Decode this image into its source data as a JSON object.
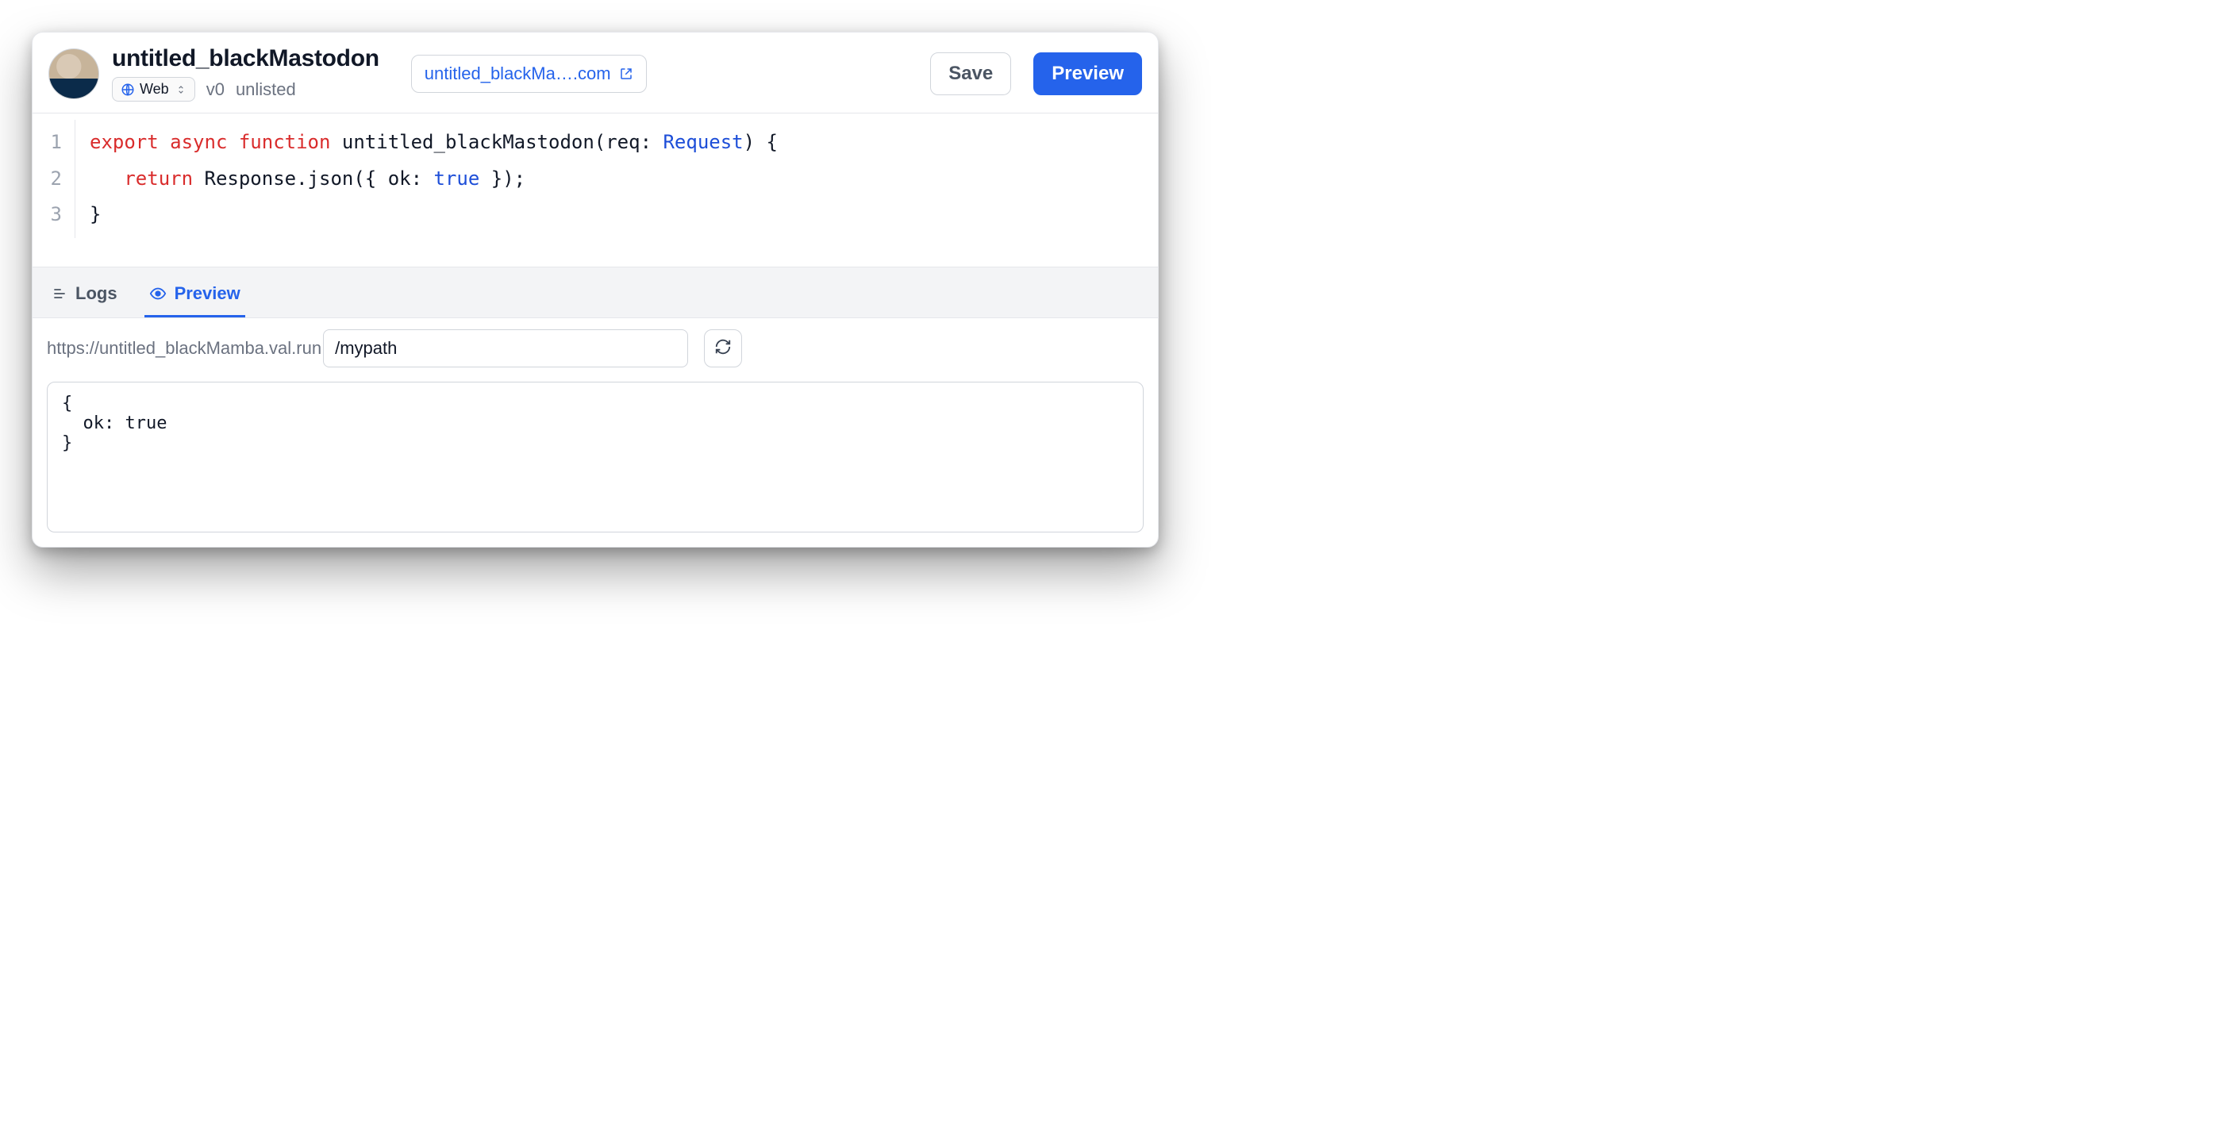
{
  "header": {
    "title": "untitled_blackMastodon",
    "type_chip": {
      "label": "Web"
    },
    "version": "v0",
    "visibility": "unlisted",
    "url_pill": "untitled_blackMa….com",
    "buttons": {
      "save": "Save",
      "preview": "Preview"
    }
  },
  "editor": {
    "line_numbers": [
      "1",
      "2",
      "3"
    ],
    "tokens": [
      [
        {
          "t": "export",
          "cls": "tok-kw"
        },
        {
          "t": " "
        },
        {
          "t": "async",
          "cls": "tok-kw"
        },
        {
          "t": " "
        },
        {
          "t": "function",
          "cls": "tok-kw"
        },
        {
          "t": " untitled_blackMastodon(req: "
        },
        {
          "t": "Request",
          "cls": "tok-type"
        },
        {
          "t": ") {"
        }
      ],
      [
        {
          "t": "   "
        },
        {
          "t": "return",
          "cls": "tok-kw"
        },
        {
          "t": " Response.json({ ok: "
        },
        {
          "t": "true",
          "cls": "tok-type"
        },
        {
          "t": " });"
        }
      ],
      [
        {
          "t": "}"
        }
      ]
    ]
  },
  "tabs": [
    {
      "id": "logs",
      "label": "Logs",
      "active": false
    },
    {
      "id": "preview",
      "label": "Preview",
      "active": true
    }
  ],
  "preview": {
    "base_url": "https://untitled_blackMamba.val.run",
    "path_value": "/mypath",
    "output": "{\n  ok: true\n}"
  }
}
